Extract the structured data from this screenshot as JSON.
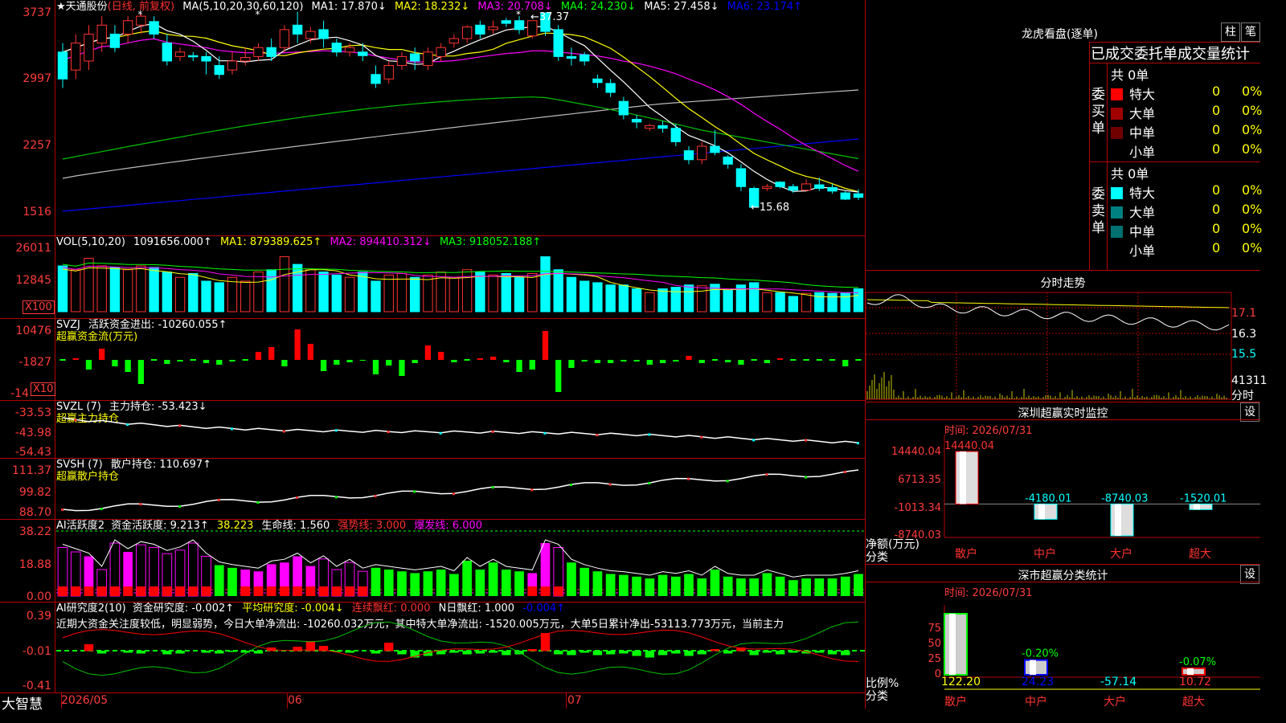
{
  "main": {
    "y_labels": [
      "3737",
      "2997",
      "2257",
      "1516"
    ],
    "title_star": "★",
    "stock_name": "天通股份",
    "period": "(日线, 前复权)",
    "ma_params": "MA(5,10,20,30,60,120)",
    "ma_values": [
      {
        "label": "MA1: 17.870↓",
        "color": "#ffffff"
      },
      {
        "label": "MA2: 18.232↓",
        "color": "#ffff00"
      },
      {
        "label": "MA3: 20.708↓",
        "color": "#ff00ff"
      },
      {
        "label": "MA4: 24.230↓",
        "color": "#00ff00"
      },
      {
        "label": "MA5: 27.458↓",
        "color": "#ffffff"
      },
      {
        "label": "MA6: 23.174↑",
        "color": "#0000ff"
      }
    ],
    "high_label": "←37.37",
    "low_label": "←15.68",
    "candles": [
      [
        30,
        33,
        29,
        34,
        0
      ],
      [
        31,
        34,
        30,
        35,
        1
      ],
      [
        32,
        35,
        31,
        36,
        1
      ],
      [
        34,
        36,
        33,
        37,
        1
      ],
      [
        33.5,
        35,
        33,
        36,
        0
      ],
      [
        35,
        36.5,
        34,
        37,
        1
      ],
      [
        36,
        37,
        35,
        37.3,
        1
      ],
      [
        35,
        36.4,
        34.5,
        37,
        0
      ],
      [
        34,
        32,
        31.5,
        35,
        0
      ],
      [
        32.5,
        33,
        32,
        33.5,
        1
      ],
      [
        32.5,
        32.6,
        32,
        33,
        0
      ],
      [
        32.5,
        32,
        30.5,
        33,
        0
      ],
      [
        31.5,
        30.5,
        30,
        32.5,
        0
      ],
      [
        31,
        32,
        30.5,
        33,
        1
      ],
      [
        32,
        32.4,
        31.5,
        33.5,
        1
      ],
      [
        32.5,
        33.5,
        32,
        34,
        1
      ],
      [
        33.5,
        32.5,
        32,
        34.5,
        0
      ],
      [
        33.5,
        35.5,
        33,
        36,
        1
      ],
      [
        36,
        35,
        34,
        37.5,
        0
      ],
      [
        34.5,
        35.3,
        34,
        35.8,
        1
      ],
      [
        35.5,
        34.5,
        33.5,
        36.5,
        0
      ],
      [
        34,
        33,
        32.5,
        34.5,
        0
      ],
      [
        33,
        33.5,
        32.5,
        34,
        1
      ],
      [
        33,
        32.6,
        32,
        34,
        0
      ],
      [
        30.5,
        29.5,
        29,
        31.5,
        0
      ],
      [
        30,
        31.5,
        29.5,
        32,
        1
      ],
      [
        31.5,
        32.5,
        31,
        33,
        1
      ],
      [
        32.8,
        32,
        31,
        33.5,
        0
      ],
      [
        31.5,
        33,
        31,
        33.5,
        1
      ],
      [
        32.5,
        33.5,
        32,
        34,
        1
      ],
      [
        34,
        34.5,
        33.5,
        35,
        1
      ],
      [
        34.5,
        35.8,
        34,
        36,
        1
      ],
      [
        36,
        35,
        34.5,
        36.5,
        0
      ],
      [
        35.5,
        35.8,
        35,
        36.5,
        1
      ],
      [
        36.5,
        36.2,
        35.8,
        36.8,
        0
      ],
      [
        36.5,
        35.5,
        35,
        37,
        0
      ],
      [
        34.8,
        36.5,
        34.5,
        36.5,
        1
      ],
      [
        37.37,
        35.3,
        34.8,
        37.4,
        0
      ],
      [
        35.5,
        32.5,
        32,
        36,
        0
      ],
      [
        32.5,
        32.3,
        31.5,
        33.5,
        0
      ],
      [
        32.7,
        32,
        31.5,
        33,
        0
      ],
      [
        30,
        29.6,
        29,
        30.5,
        0
      ],
      [
        29.5,
        28.5,
        28,
        30,
        0
      ],
      [
        27.5,
        26,
        25.5,
        28,
        0
      ],
      [
        25.5,
        25.2,
        24.5,
        26,
        0
      ],
      [
        24.5,
        24.8,
        24.2,
        25,
        1
      ],
      [
        24.8,
        24.5,
        24,
        25.3,
        0
      ],
      [
        24.5,
        23,
        22.5,
        25,
        0
      ],
      [
        22,
        21,
        20.5,
        22.5,
        0
      ],
      [
        21,
        22.5,
        20.5,
        23,
        1
      ],
      [
        22.5,
        21.8,
        21.5,
        24.3,
        0
      ],
      [
        21.3,
        20.5,
        20,
        21.5,
        0
      ],
      [
        20,
        18,
        17.5,
        20.5,
        0
      ],
      [
        17.8,
        15.7,
        15.68,
        18,
        0
      ],
      [
        17.8,
        18,
        17.5,
        18.3,
        1
      ],
      [
        18.5,
        18,
        17.8,
        18.6,
        0
      ],
      [
        18,
        17.6,
        17.3,
        18.3,
        0
      ],
      [
        17.6,
        18.3,
        17.5,
        18.8,
        1
      ],
      [
        18.2,
        17.8,
        17.5,
        19,
        0
      ],
      [
        17.9,
        17.5,
        17.2,
        18.3,
        0
      ],
      [
        17.3,
        16.6,
        16.5,
        17.5,
        0
      ],
      [
        17.2,
        16.8,
        16.5,
        17.7,
        0
      ]
    ]
  },
  "vol": {
    "y_labels": [
      "26011",
      "12845"
    ],
    "unit": "X100",
    "title": "VOL(5,10,20)",
    "vol_value": "1091656.000↑",
    "ma": [
      {
        "label": "MA1: 879389.625↑",
        "color": "#ffff00"
      },
      {
        "label": "MA2: 894410.312↓",
        "color": "#ff00ff"
      },
      {
        "label": "MA3: 918052.188↑",
        "color": "#00ff00"
      }
    ]
  },
  "svzj": {
    "y_labels": [
      "10476",
      "-1827",
      "-14"
    ],
    "unit": "X10",
    "title": "SVZJ",
    "label": "活跃资金进出: -10260.055↑",
    "sub": "超赢资金流(万元)"
  },
  "svzl": {
    "y_labels": [
      "-33.53",
      "-43.98",
      "-54.43"
    ],
    "title": "SVZL (7)",
    "label": "主力持仓: -53.423↓",
    "sub": "超赢主力持仓"
  },
  "svsh": {
    "y_labels": [
      "111.37",
      "99.82",
      "88.70"
    ],
    "title": "SVSH (7)",
    "label": "散户持仓: 110.697↑",
    "sub": "超赢散户持仓"
  },
  "ai1": {
    "y_labels": [
      "38.22",
      "18.88",
      "0.00"
    ],
    "title": "AI活跃度2",
    "label": "资金活跃度: 9.213↑",
    "v2": "38.223",
    "v3": "生命线: 1.560",
    "v4": "强势线: 3.000",
    "v5": "爆发线: 6.000"
  },
  "ai2": {
    "y_labels": [
      "0.39",
      "-0.01",
      "-0.41"
    ],
    "title": "AI研究度2(10)",
    "label": "资金研究度: -0.002↑",
    "v2": "平均研究度: -0.004↓",
    "v3": "连续飘红: 0.000",
    "v4": "N日飘红: 1.000",
    "v5": "-0.004↑",
    "comment": "近期大资金关注度较低，明显弱势，今日大单净流出: -10260.032万元，其中特大单净流出: -1520.005万元，大单5日累计净出-53113.773万元，当前主力"
  },
  "xaxis": {
    "brand": "大智慧",
    "d1": "2026/05",
    "d2": "06",
    "d3": "07"
  },
  "right": {
    "lhb_title": "龙虎看盘(逐单)",
    "btn1": "柱",
    "btn2": "笔",
    "tab_header": "已成交委托单成交量统计",
    "buy_side": "委买单",
    "sell_side": "委卖单",
    "buy_total": "共 0单",
    "sell_total": "共 0单",
    "buy_rows": [
      {
        "name": "特大",
        "count": "0",
        "pct": "0%",
        "color": "#ff0000"
      },
      {
        "name": "大单",
        "count": "0",
        "pct": "0%",
        "color": "#a00000"
      },
      {
        "name": "中单",
        "count": "0",
        "pct": "0%",
        "color": "#700000"
      },
      {
        "name": "小单",
        "count": "0",
        "pct": "0%",
        "color": "#000000"
      }
    ],
    "sell_rows": [
      {
        "name": "特大",
        "count": "0",
        "pct": "0%",
        "color": "#00ffff"
      },
      {
        "name": "大单",
        "count": "0",
        "pct": "0%",
        "color": "#008080"
      },
      {
        "name": "中单",
        "count": "0",
        "pct": "0%",
        "color": "#007070"
      },
      {
        "name": "小单",
        "count": "0",
        "pct": "0%",
        "color": "#000000"
      }
    ],
    "fenshi_title": "分时走势",
    "fenshi_y": [
      "17.1",
      "16.3",
      "15.5",
      "41311"
    ],
    "fenshi_unit": "分时",
    "monitor_title": "深圳超赢实时监控",
    "monitor_btn": "设",
    "monitor_time": "时间: 2026/07/31",
    "monitor_y": [
      "14440.04",
      "6713.35",
      "-1013.34",
      "-8740.03"
    ],
    "monitor_axis_unit": "净额(万元)",
    "monitor_axis_cat": "分类",
    "monitor_values": [
      "14440.04",
      "-4180.01",
      "-8740.03",
      "-1520.01"
    ],
    "monitor_cats": [
      "散户",
      "中户",
      "大户",
      "超大"
    ],
    "class_title": "深市超赢分类统计",
    "class_btn": "设",
    "class_time": "时间: 2026/07/31",
    "class_y": [
      "75",
      "50",
      "25",
      "0"
    ],
    "class_axis_unit": "比例%",
    "class_axis_cat": "分类",
    "class_top": [
      "",
      "-0.20%",
      "",
      "-0.07%"
    ],
    "class_values": [
      "122.20",
      "24.23",
      "-57.14",
      "10.72"
    ],
    "class_cats": [
      "散户",
      "中户",
      "大户",
      "超大"
    ]
  },
  "chart_data": [
    {
      "type": "bar",
      "title": "深圳超赢实时监控",
      "categories": [
        "散户",
        "中户",
        "大户",
        "超大"
      ],
      "values": [
        14440.04,
        -4180.01,
        -8740.03,
        -1520.01
      ],
      "ylabel": "净额(万元)",
      "ylim": [
        -8740.03,
        14440.04
      ]
    },
    {
      "type": "bar",
      "title": "深市超赢分类统计",
      "categories": [
        "散户",
        "中户",
        "大户",
        "超大"
      ],
      "values": [
        122.2,
        24.23,
        -57.14,
        10.72
      ],
      "ylabel": "比例%",
      "ylim": [
        0,
        75
      ]
    }
  ]
}
